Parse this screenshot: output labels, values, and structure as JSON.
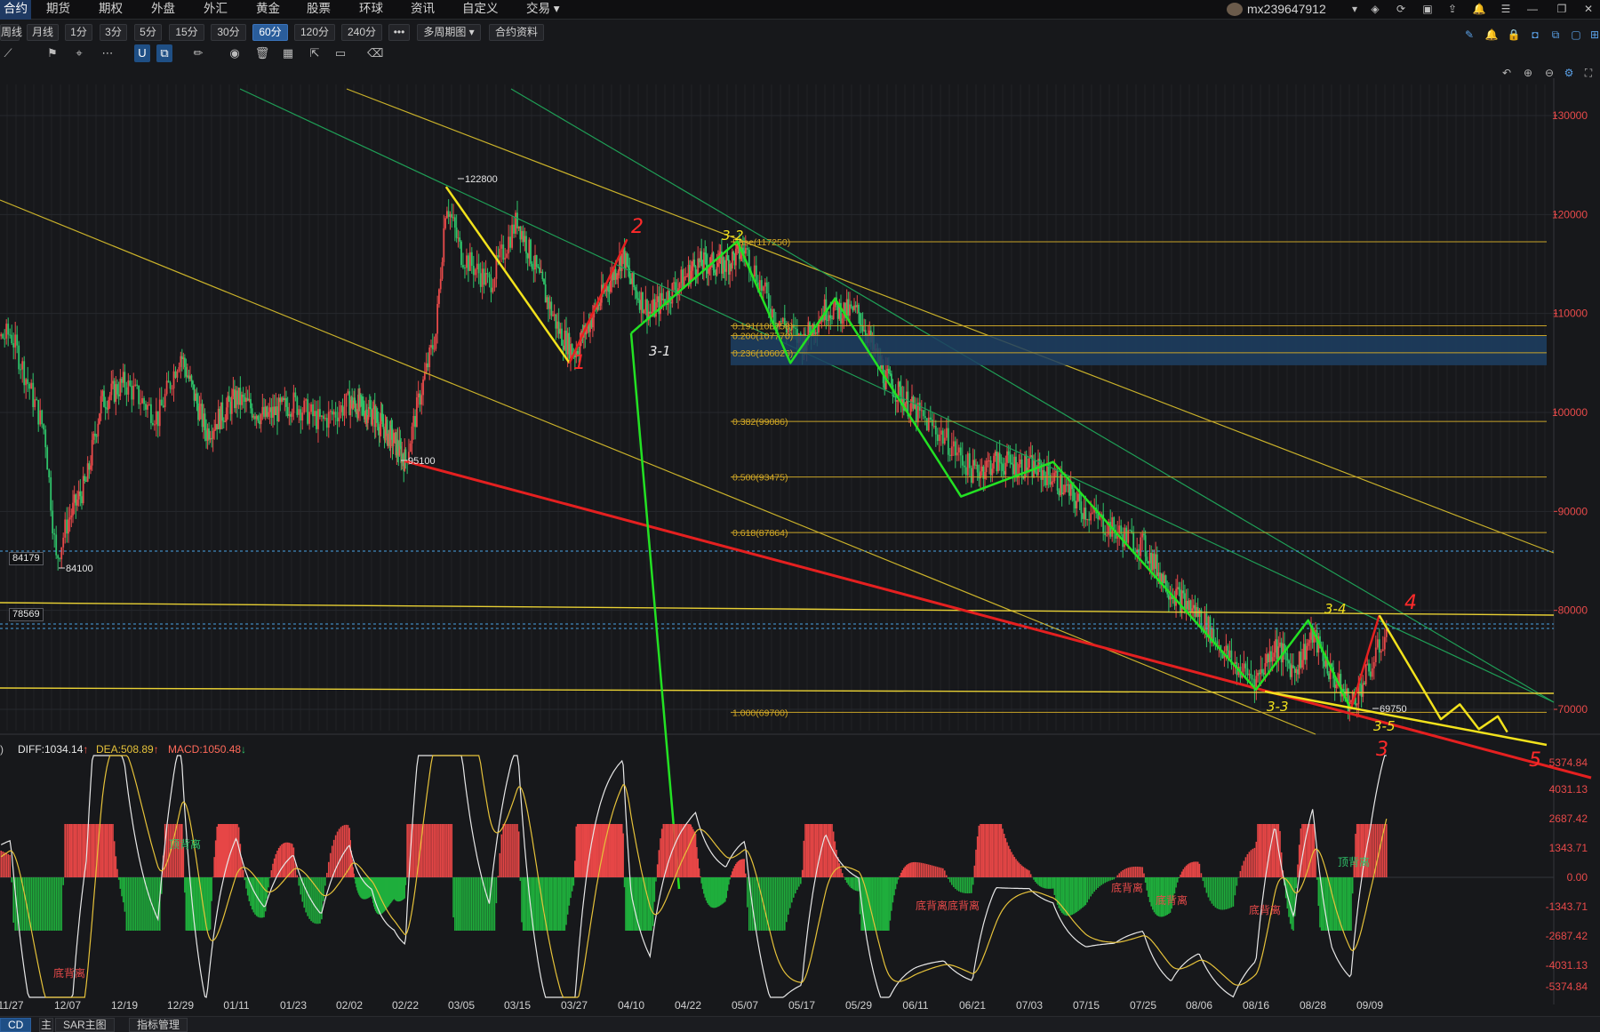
{
  "menu": {
    "items": [
      "合约",
      "期货",
      "期权",
      "外盘",
      "外汇",
      "黄金",
      "股票",
      "环球",
      "资讯",
      "自定义",
      "交易 ▾"
    ],
    "user": "mx239647912"
  },
  "toolbar": {
    "periods": [
      "周线",
      "月线",
      "1分",
      "3分",
      "5分",
      "15分",
      "30分",
      "60分",
      "120分",
      "240分"
    ],
    "selected_period": "60分",
    "more": "•••",
    "multi_period": "多周期图 ▾",
    "contract_info": "合约资料"
  },
  "side_boxes": {
    "upper": "84179",
    "lower": "78569"
  },
  "footer": {
    "tab1": "CD",
    "tab2": "SAR主图",
    "tab3": "指标管理",
    "tab1_icon": "主"
  },
  "macd": {
    "prefix": ")",
    "diff": "DIFF:1034.14",
    "dea": "DEA:508.89",
    "macd": "MACD:1050.48",
    "diff_arrow": "↑",
    "dea_arrow": "↑",
    "macd_arrow": "↓",
    "colors": {
      "diff": "#e8e8e8",
      "dea": "#e6c23a",
      "macd": "#ff6a5a",
      "up_bar": "#e64646",
      "down_bar": "#1fae3c"
    }
  },
  "colors": {
    "background": "#17181b",
    "grid": "#26282d",
    "up_candle": "#e84a4a",
    "down_candle": "#2fc46a",
    "fib_line": "#c8a329",
    "red_line": "#e52020",
    "green_wave": "#23e123",
    "yellow_wave": "#f2e21c"
  },
  "chart_data": {
    "type": "candlestick",
    "price_axis": {
      "ticks": [
        "130000",
        "120000",
        "110000",
        "100000",
        "90000",
        "80000",
        "70000"
      ],
      "ylim": [
        67500,
        132000
      ]
    },
    "macd_axis": {
      "ticks": [
        "5374.84",
        "4031.13",
        "2687.42",
        "1343.71",
        "0.00",
        "-1343.71",
        "-2687.42",
        "-4031.13",
        "-5374.84"
      ]
    },
    "x_ticks": [
      "11/27",
      "12/07",
      "12/19",
      "12/29",
      "01/11",
      "01/23",
      "02/02",
      "02/22",
      "03/05",
      "03/15",
      "03/27",
      "04/10",
      "04/22",
      "05/07",
      "05/17",
      "05/29",
      "06/11",
      "06/21",
      "07/03",
      "07/15",
      "07/25",
      "08/06",
      "08/16",
      "08/28",
      "09/09"
    ],
    "price_labels": [
      {
        "text": "122800",
        "value": 122800
      },
      {
        "text": "95100",
        "value": 95100
      },
      {
        "text": "84100",
        "value": 84100
      },
      {
        "text": "69750",
        "value": 69750
      }
    ],
    "fibonacci": [
      {
        "label": "Base(117250)",
        "value": 117250
      },
      {
        "label": "0.191(108758)",
        "value": 108758
      },
      {
        "label": "0.200(107770)",
        "value": 107770
      },
      {
        "label": "0.236(106026)",
        "value": 106026
      },
      {
        "label": "0.382(99086)",
        "value": 99086
      },
      {
        "label": "0.500(93475)",
        "value": 93475
      },
      {
        "label": "0.618(87864)",
        "value": 87864
      },
      {
        "label": "1.000(69700)",
        "value": 69700
      }
    ],
    "levels": [
      84179,
      78569,
      79000,
      72000
    ],
    "annotations": [
      {
        "text": "1",
        "color": "red"
      },
      {
        "text": "2",
        "color": "red"
      },
      {
        "text": "3",
        "color": "red"
      },
      {
        "text": "4",
        "color": "red"
      },
      {
        "text": "5",
        "color": "red"
      },
      {
        "text": "3-1",
        "color": "white"
      },
      {
        "text": "3-2",
        "color": "yellow"
      },
      {
        "text": "3-3",
        "color": "yellow"
      },
      {
        "text": "3-4",
        "color": "yellow"
      },
      {
        "text": "3-5",
        "color": "yellow"
      }
    ],
    "macd_divergence_labels": [
      "底背离",
      "顶背离",
      "底背离",
      "底背离底背离",
      "底背离",
      "底背离",
      "顶背离"
    ],
    "yellow_path": [
      {
        "x": "03/02",
        "y": 122800
      },
      {
        "x": "03/26",
        "y": 105000
      }
    ],
    "red_path": [
      {
        "x": "03/26",
        "y": 105000
      },
      {
        "x": "04/09",
        "y": 117500
      }
    ],
    "green_path": [
      {
        "x": "04/10",
        "y": 108000
      },
      {
        "x": "05/05",
        "y": 117300
      },
      {
        "x": "05/15",
        "y": 105000
      },
      {
        "x": "05/24",
        "y": 111500
      },
      {
        "x": "06/19",
        "y": 91500
      },
      {
        "x": "07/08",
        "y": 95000
      },
      {
        "x": "08/16",
        "y": 72000
      },
      {
        "x": "08/27",
        "y": 79000
      },
      {
        "x": "09/05",
        "y": 70000
      }
    ],
    "red_path2": [
      {
        "x": "09/05",
        "y": 70000
      },
      {
        "x": "09/11",
        "y": 79500
      }
    ],
    "yellow_projection": [
      {
        "x": "09/11",
        "y": 79500
      },
      {
        "x": "09/24",
        "y": 69000
      },
      {
        "x": "09/28",
        "y": 70500
      },
      {
        "x": "10/02",
        "y": 68000
      },
      {
        "x": "10/06",
        "y": 69300
      },
      {
        "x": "10/08",
        "y": 67700
      }
    ]
  }
}
